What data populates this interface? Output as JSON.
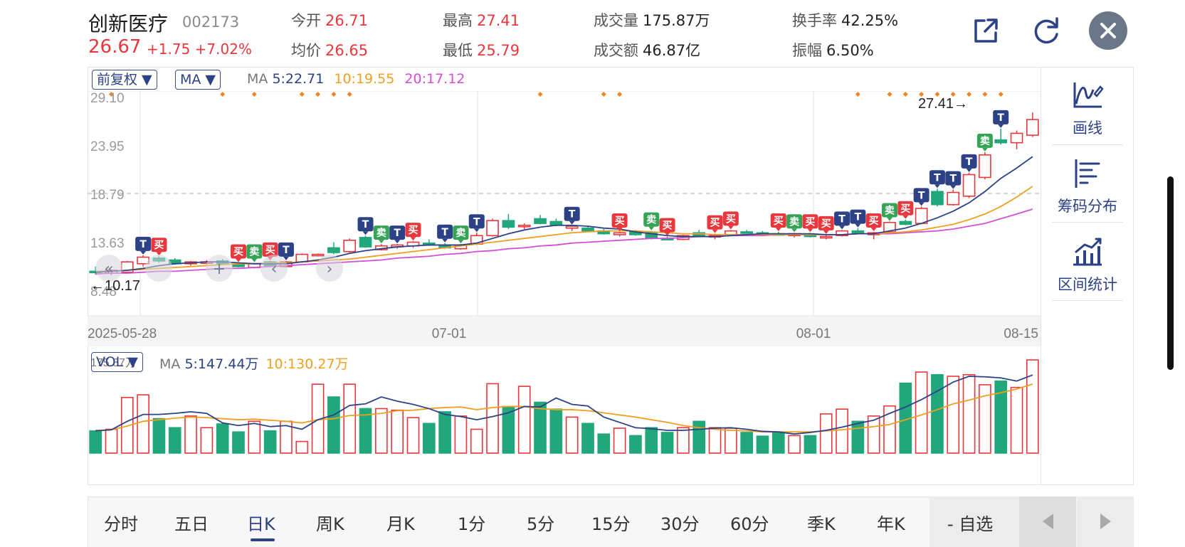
{
  "header": {
    "name": "创新医疗",
    "code": "002173",
    "price": "26.67",
    "change": "+1.75",
    "change_pct": "+7.02%",
    "stats": [
      {
        "key": "今开",
        "value": "26.71",
        "tone": "red"
      },
      {
        "key": "最高",
        "value": "27.41",
        "tone": "red"
      },
      {
        "key": "成交量",
        "value": "175.87万",
        "tone": "dark"
      },
      {
        "key": "换手率",
        "value": "42.25%",
        "tone": "dark"
      },
      {
        "key": "均价",
        "value": "26.65",
        "tone": "red"
      },
      {
        "key": "最低",
        "value": "25.79",
        "tone": "red"
      },
      {
        "key": "成交额",
        "value": "46.87亿",
        "tone": "dark"
      },
      {
        "key": "振幅",
        "value": "6.50%",
        "tone": "dark"
      }
    ],
    "icons": [
      "share-icon",
      "refresh-icon",
      "close-icon"
    ]
  },
  "price_panel": {
    "adjust_chip": "前复权 ▼",
    "indicator_chip": "MA ▼",
    "ma_prefix": "MA",
    "ma5": "5:22.71",
    "ma10": "10:19.55",
    "ma20": "20:17.12",
    "y_ticks": [
      "29.10",
      "23.95",
      "18.79",
      "13.63",
      "8.48"
    ],
    "high_marker": "27.41→",
    "low_marker": "←10.17",
    "x_dates": [
      "2025-05-28",
      "07-01",
      "08-01",
      "08-15"
    ]
  },
  "volume_panel": {
    "chip": "VOL ▼",
    "ma_prefix": "MA",
    "ma5": "5:147.44万",
    "ma10": "10:130.27万",
    "max_label": "175.87万"
  },
  "tools": [
    {
      "label": "画线",
      "icon": "draw-line-icon"
    },
    {
      "label": "筹码分布",
      "icon": "chip-distribution-icon"
    },
    {
      "label": "区间统计",
      "icon": "range-stats-icon"
    }
  ],
  "tabs": [
    "分时",
    "五日",
    "日K",
    "周K",
    "月K",
    "1分",
    "5分",
    "15分",
    "30分",
    "60分",
    "季K",
    "年K"
  ],
  "active_tab": "日K",
  "zixuan": "- 自选",
  "colors": {
    "up": "#e8383d",
    "down": "#21a77b",
    "ma5": "#2d4286",
    "ma10": "#f0a020",
    "ma20": "#d24fd8",
    "accent": "#2d4286",
    "dot": "#f5841f"
  },
  "chart_data": {
    "type": "candlestick",
    "y_axis_labels": [
      "29.10",
      "23.95",
      "18.79",
      "13.63",
      "8.48"
    ],
    "candles": [
      {
        "o": 10.5,
        "h": 11.0,
        "l": 10.17,
        "c": 10.4
      },
      {
        "o": 10.3,
        "h": 10.7,
        "l": 10.1,
        "c": 10.6
      },
      {
        "o": 10.4,
        "h": 11.6,
        "l": 10.3,
        "c": 11.5
      },
      {
        "o": 11.3,
        "h": 12.2,
        "l": 11.0,
        "c": 12.0
      },
      {
        "o": 11.9,
        "h": 12.1,
        "l": 11.4,
        "c": 11.6
      },
      {
        "o": 11.7,
        "h": 11.9,
        "l": 11.2,
        "c": 11.3
      },
      {
        "o": 11.3,
        "h": 11.6,
        "l": 11.1,
        "c": 11.5
      },
      {
        "o": 11.4,
        "h": 11.7,
        "l": 11.2,
        "c": 11.5
      },
      {
        "o": 11.6,
        "h": 11.8,
        "l": 11.2,
        "c": 11.3
      },
      {
        "o": 11.2,
        "h": 11.4,
        "l": 10.9,
        "c": 11.0
      },
      {
        "o": 10.9,
        "h": 11.4,
        "l": 10.8,
        "c": 11.3
      },
      {
        "o": 11.5,
        "h": 11.6,
        "l": 11.0,
        "c": 11.1
      },
      {
        "o": 11.0,
        "h": 11.6,
        "l": 10.9,
        "c": 11.5
      },
      {
        "o": 11.5,
        "h": 12.4,
        "l": 11.4,
        "c": 12.3
      },
      {
        "o": 12.3,
        "h": 12.4,
        "l": 12.2,
        "c": 12.3
      },
      {
        "o": 13.0,
        "h": 13.6,
        "l": 12.3,
        "c": 12.5
      },
      {
        "o": 12.6,
        "h": 14.0,
        "l": 12.5,
        "c": 13.8
      },
      {
        "o": 14.1,
        "h": 14.3,
        "l": 13.0,
        "c": 13.1
      },
      {
        "o": 12.8,
        "h": 13.4,
        "l": 12.7,
        "c": 13.2
      },
      {
        "o": 13.1,
        "h": 13.4,
        "l": 12.9,
        "c": 13.3
      },
      {
        "o": 13.2,
        "h": 13.7,
        "l": 13.0,
        "c": 13.6
      },
      {
        "o": 13.5,
        "h": 13.9,
        "l": 13.2,
        "c": 13.3
      },
      {
        "o": 13.3,
        "h": 13.5,
        "l": 12.9,
        "c": 13.0
      },
      {
        "o": 12.9,
        "h": 13.4,
        "l": 12.8,
        "c": 13.3
      },
      {
        "o": 13.4,
        "h": 14.6,
        "l": 13.3,
        "c": 14.3
      },
      {
        "o": 14.3,
        "h": 16.1,
        "l": 14.2,
        "c": 15.9
      },
      {
        "o": 15.9,
        "h": 16.6,
        "l": 15.0,
        "c": 15.2
      },
      {
        "o": 15.3,
        "h": 15.6,
        "l": 15.0,
        "c": 15.4
      },
      {
        "o": 16.1,
        "h": 16.5,
        "l": 15.5,
        "c": 15.6
      },
      {
        "o": 15.8,
        "h": 16.1,
        "l": 15.3,
        "c": 15.4
      },
      {
        "o": 15.1,
        "h": 15.4,
        "l": 14.8,
        "c": 15.3
      },
      {
        "o": 15.1,
        "h": 15.3,
        "l": 14.7,
        "c": 14.8
      },
      {
        "o": 14.8,
        "h": 15.0,
        "l": 14.4,
        "c": 14.5
      },
      {
        "o": 14.4,
        "h": 14.7,
        "l": 14.2,
        "c": 14.6
      },
      {
        "o": 14.7,
        "h": 14.9,
        "l": 14.3,
        "c": 14.4
      },
      {
        "o": 14.6,
        "h": 14.8,
        "l": 13.9,
        "c": 14.0
      },
      {
        "o": 14.0,
        "h": 14.2,
        "l": 13.8,
        "c": 13.9
      },
      {
        "o": 13.9,
        "h": 14.4,
        "l": 13.8,
        "c": 14.3
      },
      {
        "o": 14.6,
        "h": 14.9,
        "l": 14.2,
        "c": 14.3
      },
      {
        "o": 14.2,
        "h": 14.5,
        "l": 13.9,
        "c": 14.3
      },
      {
        "o": 14.4,
        "h": 14.9,
        "l": 14.3,
        "c": 14.8
      },
      {
        "o": 14.7,
        "h": 14.9,
        "l": 14.5,
        "c": 14.6
      },
      {
        "o": 14.6,
        "h": 14.8,
        "l": 14.4,
        "c": 14.5
      },
      {
        "o": 14.5,
        "h": 14.7,
        "l": 14.3,
        "c": 14.4
      },
      {
        "o": 14.3,
        "h": 14.6,
        "l": 14.1,
        "c": 14.5
      },
      {
        "o": 14.4,
        "h": 14.6,
        "l": 14.1,
        "c": 14.2
      },
      {
        "o": 14.1,
        "h": 14.4,
        "l": 13.9,
        "c": 14.2
      },
      {
        "o": 14.3,
        "h": 14.9,
        "l": 14.2,
        "c": 14.8
      },
      {
        "o": 14.8,
        "h": 15.1,
        "l": 14.5,
        "c": 14.6
      },
      {
        "o": 14.4,
        "h": 14.7,
        "l": 13.9,
        "c": 14.6
      },
      {
        "o": 14.7,
        "h": 15.8,
        "l": 14.6,
        "c": 15.7
      },
      {
        "o": 15.8,
        "h": 16.0,
        "l": 15.4,
        "c": 15.5
      },
      {
        "o": 15.6,
        "h": 17.4,
        "l": 15.5,
        "c": 17.2
      },
      {
        "o": 19.0,
        "h": 19.3,
        "l": 17.4,
        "c": 17.6
      },
      {
        "o": 17.6,
        "h": 19.2,
        "l": 17.5,
        "c": 18.9
      },
      {
        "o": 18.5,
        "h": 21.0,
        "l": 18.3,
        "c": 20.8
      },
      {
        "o": 20.5,
        "h": 23.2,
        "l": 20.3,
        "c": 22.9
      },
      {
        "o": 24.5,
        "h": 25.7,
        "l": 24.0,
        "c": 24.2
      },
      {
        "o": 24.2,
        "h": 25.5,
        "l": 23.5,
        "c": 25.2
      },
      {
        "o": 25.0,
        "h": 27.41,
        "l": 24.8,
        "c": 26.67
      }
    ],
    "ma5": [
      10.4,
      10.5,
      10.6,
      10.8,
      11.1,
      11.3,
      11.4,
      11.5,
      11.5,
      11.4,
      11.3,
      11.3,
      11.3,
      11.5,
      11.7,
      12.0,
      12.4,
      12.7,
      12.9,
      13.1,
      13.2,
      13.3,
      13.3,
      13.3,
      13.5,
      14.0,
      14.5,
      14.9,
      15.2,
      15.4,
      15.4,
      15.3,
      15.1,
      15.0,
      14.7,
      14.5,
      14.3,
      14.2,
      14.2,
      14.2,
      14.3,
      14.4,
      14.5,
      14.5,
      14.5,
      14.5,
      14.4,
      14.4,
      14.5,
      14.5,
      14.8,
      15.1,
      15.6,
      16.2,
      16.9,
      17.8,
      19.0,
      20.4,
      21.5,
      22.71
    ],
    "ma10": [
      10.5,
      10.5,
      10.6,
      10.7,
      10.8,
      10.9,
      11.0,
      11.1,
      11.2,
      11.3,
      11.3,
      11.4,
      11.4,
      11.5,
      11.6,
      11.7,
      11.8,
      12.0,
      12.2,
      12.4,
      12.6,
      12.8,
      13.0,
      13.2,
      13.4,
      13.6,
      13.8,
      14.0,
      14.2,
      14.4,
      14.6,
      14.7,
      14.8,
      14.8,
      14.8,
      14.7,
      14.6,
      14.5,
      14.5,
      14.4,
      14.4,
      14.4,
      14.4,
      14.4,
      14.4,
      14.4,
      14.4,
      14.4,
      14.5,
      14.5,
      14.6,
      14.7,
      14.9,
      15.2,
      15.5,
      16.0,
      16.6,
      17.4,
      18.4,
      19.55
    ],
    "ma20": [
      10.2,
      10.3,
      10.3,
      10.4,
      10.5,
      10.5,
      10.6,
      10.7,
      10.8,
      10.8,
      10.9,
      11.0,
      11.1,
      11.2,
      11.3,
      11.4,
      11.5,
      11.6,
      11.7,
      11.9,
      12.0,
      12.1,
      12.3,
      12.4,
      12.6,
      12.7,
      12.9,
      13.0,
      13.2,
      13.3,
      13.5,
      13.6,
      13.7,
      13.8,
      13.9,
      14.0,
      14.0,
      14.1,
      14.2,
      14.2,
      14.3,
      14.3,
      14.3,
      14.4,
      14.4,
      14.4,
      14.4,
      14.4,
      14.5,
      14.5,
      14.5,
      14.6,
      14.7,
      14.8,
      15.0,
      15.3,
      15.6,
      16.1,
      16.6,
      17.12
    ],
    "signals": [
      {
        "i": 3,
        "t": "T"
      },
      {
        "i": 4,
        "t": "买"
      },
      {
        "i": 9,
        "t": "买"
      },
      {
        "i": 10,
        "t": "卖"
      },
      {
        "i": 11,
        "t": "买"
      },
      {
        "i": 12,
        "t": "T"
      },
      {
        "i": 17,
        "t": "T"
      },
      {
        "i": 18,
        "t": "卖"
      },
      {
        "i": 19,
        "t": "T"
      },
      {
        "i": 20,
        "t": "买"
      },
      {
        "i": 22,
        "t": "T"
      },
      {
        "i": 23,
        "t": "卖"
      },
      {
        "i": 24,
        "t": "T"
      },
      {
        "i": 30,
        "t": "T"
      },
      {
        "i": 33,
        "t": "买"
      },
      {
        "i": 35,
        "t": "卖"
      },
      {
        "i": 36,
        "t": "买"
      },
      {
        "i": 39,
        "t": "买"
      },
      {
        "i": 40,
        "t": "买"
      },
      {
        "i": 43,
        "t": "买"
      },
      {
        "i": 44,
        "t": "卖"
      },
      {
        "i": 45,
        "t": "买"
      },
      {
        "i": 46,
        "t": "买"
      },
      {
        "i": 47,
        "t": "T"
      },
      {
        "i": 48,
        "t": "T"
      },
      {
        "i": 49,
        "t": "买"
      },
      {
        "i": 50,
        "t": "卖"
      },
      {
        "i": 51,
        "t": "买"
      },
      {
        "i": 52,
        "t": "T"
      },
      {
        "i": 53,
        "t": "T"
      },
      {
        "i": 54,
        "t": "T"
      },
      {
        "i": 55,
        "t": "T"
      },
      {
        "i": 56,
        "t": "卖"
      },
      {
        "i": 57,
        "t": "T"
      }
    ],
    "top_dots": [
      1,
      8,
      10,
      13,
      14,
      15,
      16,
      28,
      32,
      33,
      48,
      50,
      51,
      52,
      53,
      54,
      55,
      56,
      57
    ],
    "volume": [
      42,
      45,
      105,
      110,
      65,
      48,
      70,
      48,
      55,
      40,
      60,
      42,
      60,
      22,
      130,
      106,
      130,
      84,
      84,
      81,
      67,
      56,
      78,
      70,
      45,
      131,
      88,
      126,
      96,
      83,
      68,
      56,
      36,
      47,
      33,
      48,
      39,
      48,
      60,
      48,
      47,
      39,
      32,
      40,
      33,
      33,
      74,
      83,
      60,
      70,
      89,
      132,
      153,
      148,
      145,
      148,
      129,
      136,
      124,
      175.87
    ],
    "vol_ma5": [
      42,
      44,
      60,
      73,
      73,
      75,
      78,
      75,
      57,
      52,
      56,
      50,
      52,
      45,
      63,
      72,
      90,
      93,
      106,
      98,
      92,
      84,
      73,
      69,
      63,
      69,
      76,
      88,
      87,
      104,
      92,
      89,
      68,
      58,
      48,
      46,
      43,
      43,
      45,
      47,
      48,
      45,
      41,
      40,
      36,
      39,
      43,
      49,
      56,
      62,
      75,
      87,
      101,
      117,
      134,
      145,
      144,
      142,
      136,
      147.44
    ],
    "vol_ma10": [
      43,
      44,
      51,
      60,
      63,
      66,
      68,
      67,
      65,
      63,
      64,
      62,
      60,
      57,
      63,
      65,
      71,
      72,
      75,
      80,
      81,
      84,
      86,
      87,
      82,
      86,
      88,
      88,
      84,
      82,
      82,
      80,
      76,
      72,
      68,
      63,
      58,
      52,
      48,
      45,
      43,
      42,
      40,
      40,
      40,
      40,
      42,
      44,
      47,
      50,
      54,
      63,
      72,
      82,
      93,
      100,
      108,
      114,
      121,
      130.27
    ]
  }
}
